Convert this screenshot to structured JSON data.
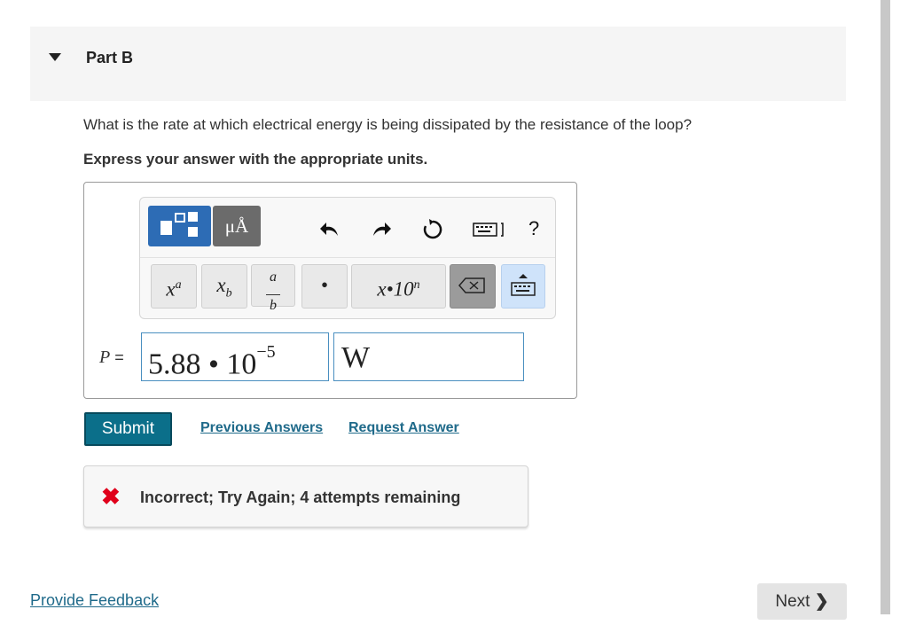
{
  "part": {
    "title": "Part B"
  },
  "question": "What is the rate at which electrical energy is being dissipated by the resistance of the loop?",
  "instruction": "Express your answer with the appropriate units.",
  "toolbar": {
    "units_label": "μÅ",
    "keys": {
      "superscript": "xa",
      "subscript": "xb",
      "fraction": "a/b",
      "dot": "•",
      "sci": "x•10n"
    }
  },
  "answer": {
    "variable": "P",
    "equals": "=",
    "mantissa": "5.88 • 10",
    "exponent": "−5",
    "unit": "W"
  },
  "actions": {
    "submit": "Submit",
    "previous_answers": "Previous Answers",
    "request_answer": "Request Answer"
  },
  "feedback": "Incorrect; Try Again; 4 attempts remaining",
  "footer": {
    "provide_feedback": "Provide Feedback",
    "next": "Next"
  },
  "colors": {
    "accent": "#0b6f8a",
    "error": "#e0001b",
    "link": "#1f6a8a"
  }
}
